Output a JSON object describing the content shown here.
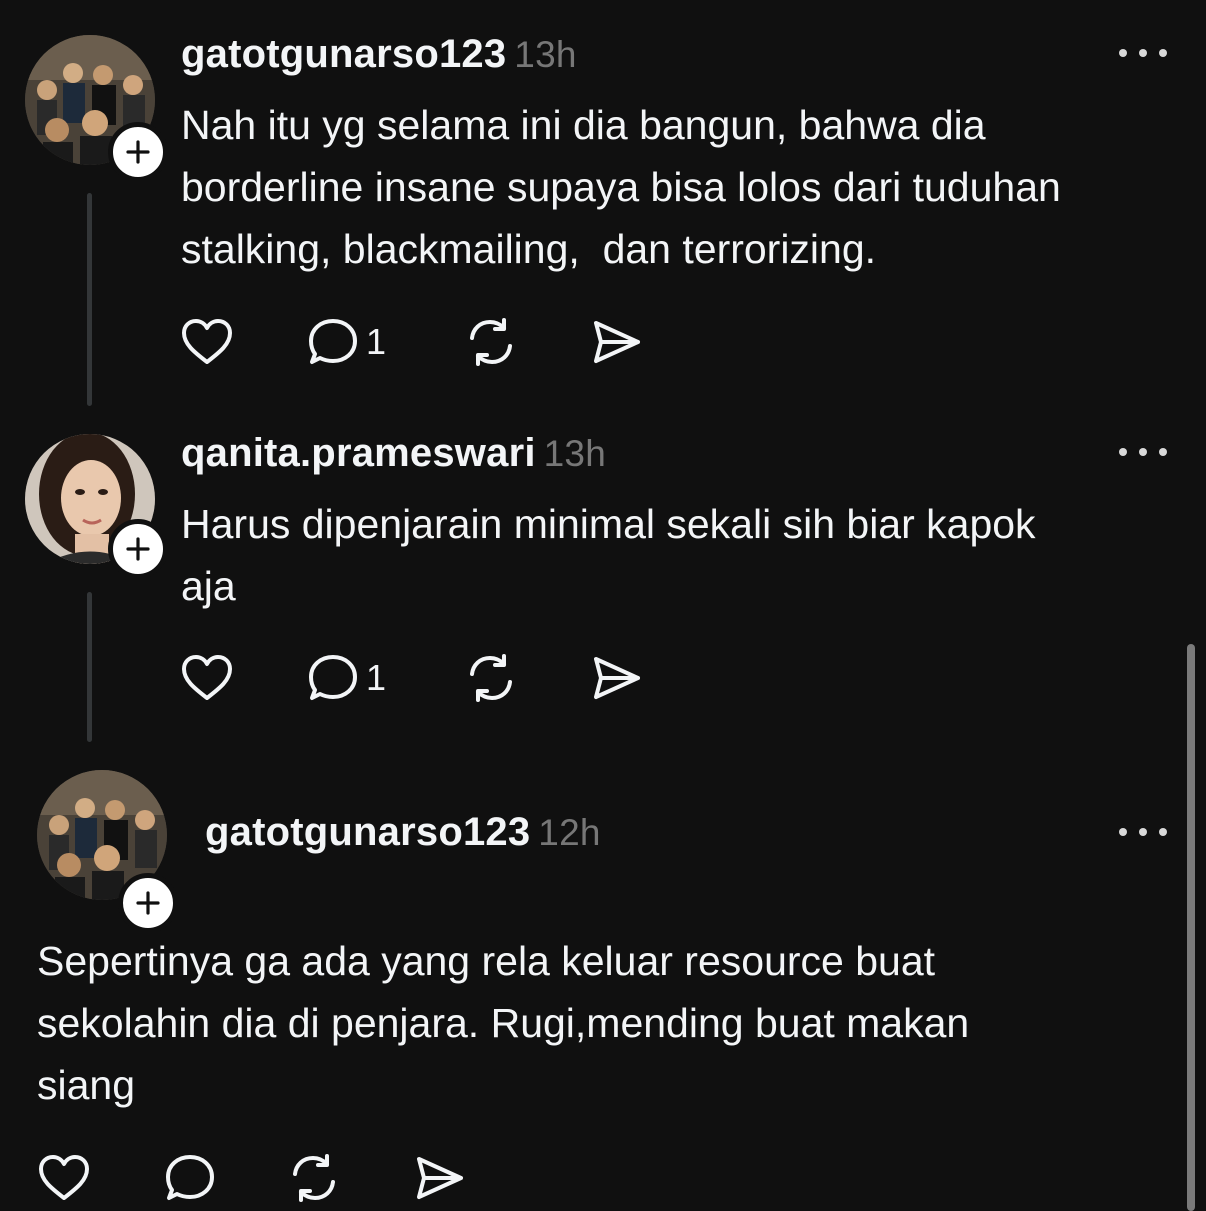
{
  "posts": [
    {
      "username": "gatotgunarso123",
      "time": "13h",
      "text": "Nah itu yg selama ini dia bangun, bahwa dia\nborderline insane supaya bisa lolos dari tuduhan\nstalking, blackmailing,  dan terrorizing.",
      "reply_count": "1"
    },
    {
      "username": "qanita.prameswari",
      "time": "13h",
      "text": "Harus dipenjarain minimal sekali sih biar kapok\naja",
      "reply_count": "1"
    },
    {
      "username": "gatotgunarso123",
      "time": "12h",
      "text": "Sepertinya ga ada yang rela keluar resource buat\nsekolahin dia di penjara. Rugi,mending buat makan\nsiang",
      "reply_count": ""
    }
  ],
  "icons": {
    "like": "heart-icon",
    "reply": "comment-icon",
    "repost": "repost-icon",
    "share": "send-icon",
    "more": "more-dots-icon",
    "follow": "plus-icon"
  },
  "colors": {
    "background": "#101010",
    "text": "#f3f5f7",
    "muted": "#777777",
    "thread_line": "#333638"
  }
}
